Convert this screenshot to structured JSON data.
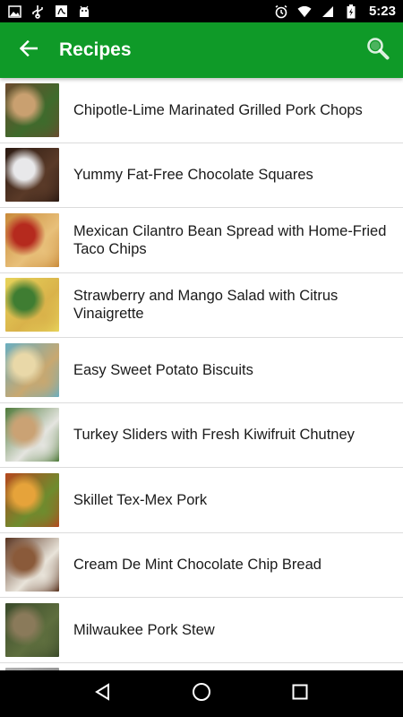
{
  "status_bar": {
    "time": "5:23",
    "left_icons": [
      "image-icon",
      "usb-icon",
      "pdf-icon",
      "android-icon"
    ],
    "right_icons": [
      "alarm-icon",
      "wifi-icon",
      "signal-icon",
      "battery-icon"
    ]
  },
  "app_bar": {
    "title": "Recipes",
    "color": "#0f9a28"
  },
  "recipes": [
    {
      "title": "Chipotle-Lime Marinated Grilled Pork Chops",
      "thumb_colors": [
        "#6b4a2e",
        "#c9a070",
        "#3e6b2c"
      ]
    },
    {
      "title": "Yummy Fat-Free Chocolate Squares",
      "thumb_colors": [
        "#2b1a12",
        "#e8e8ea",
        "#5a3a28"
      ]
    },
    {
      "title": "Mexican Cilantro Bean Spread with Home-Fried Taco Chips",
      "thumb_colors": [
        "#c98a3a",
        "#b52a1e",
        "#e8c07a"
      ]
    },
    {
      "title": "Strawberry and Mango Salad with Citrus Vinaigrette",
      "thumb_colors": [
        "#e7d35a",
        "#3f7d32",
        "#d9b24a"
      ]
    },
    {
      "title": "Easy Sweet Potato Biscuits",
      "thumb_colors": [
        "#6aaec0",
        "#e9d8a8",
        "#c8a870"
      ]
    },
    {
      "title": "Turkey Sliders with Fresh Kiwifruit Chutney",
      "thumb_colors": [
        "#4f7a3a",
        "#caa274",
        "#e5e5e0"
      ]
    },
    {
      "title": "Skillet Tex-Mex Pork",
      "thumb_colors": [
        "#b5481e",
        "#e6a33a",
        "#6e8c2e"
      ]
    },
    {
      "title": "Cream De Mint Chocolate Chip Bread",
      "thumb_colors": [
        "#5a3420",
        "#8a5a3a",
        "#e9e4da"
      ]
    },
    {
      "title": "Milwaukee Pork Stew",
      "thumb_colors": [
        "#3a4a2a",
        "#8a7a5a",
        "#5e6e3e"
      ]
    },
    {
      "title": "",
      "thumb_colors": [
        "#b0b0b0",
        "#d0d0d0",
        "#909090"
      ]
    }
  ],
  "nav_bar": {
    "buttons": [
      "back-triangle-icon",
      "home-circle-icon",
      "recents-square-icon"
    ]
  }
}
